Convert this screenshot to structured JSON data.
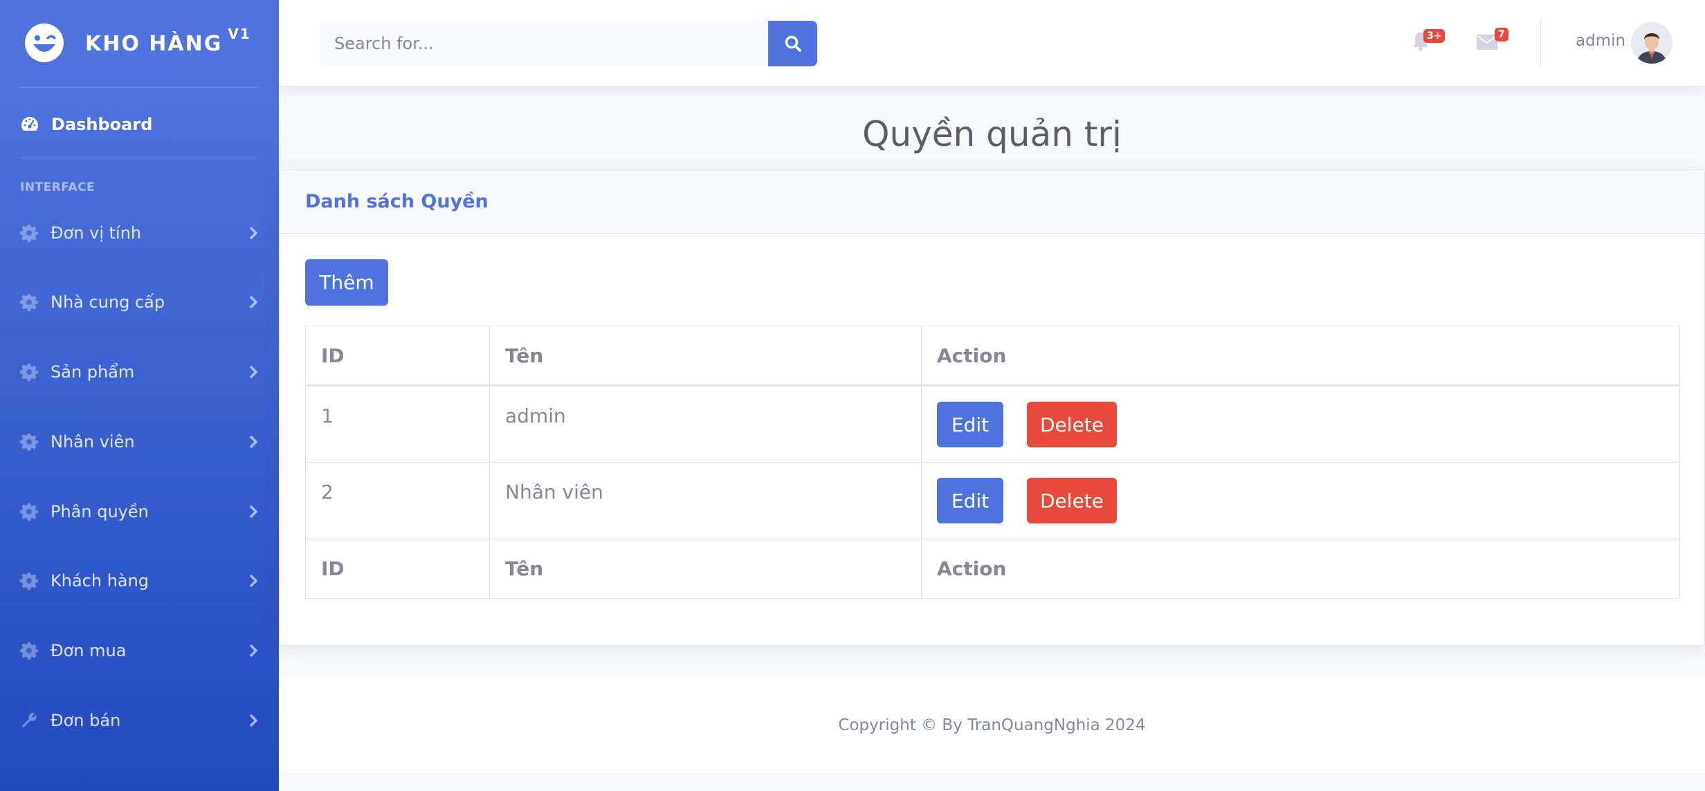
{
  "brand": {
    "name": "KHO HÀNG",
    "version": "V1"
  },
  "sidebar": {
    "dashboard_label": "Dashboard",
    "section_heading": "INTERFACE",
    "items": [
      {
        "label": "Đơn vị tính",
        "icon": "gear-icon"
      },
      {
        "label": "Nhà cung cấp",
        "icon": "gear-icon"
      },
      {
        "label": "Sản phẩm",
        "icon": "gear-icon"
      },
      {
        "label": "Nhân viên",
        "icon": "gear-icon"
      },
      {
        "label": "Phân quyền",
        "icon": "gear-icon"
      },
      {
        "label": "Khách hàng",
        "icon": "gear-icon"
      },
      {
        "label": "Đơn mua",
        "icon": "gear-icon"
      },
      {
        "label": "Đơn bán",
        "icon": "wrench-icon"
      }
    ]
  },
  "topbar": {
    "search_placeholder": "Search for...",
    "alerts_badge": "3+",
    "messages_badge": "7",
    "user_name": "admin"
  },
  "page": {
    "title": "Quyền quản trị",
    "card_title": "Danh sách Quyền",
    "add_label": "Thêm"
  },
  "table": {
    "headers": [
      "ID",
      "Tên",
      "Action"
    ],
    "footers": [
      "ID",
      "Tên",
      "Action"
    ],
    "rows": [
      {
        "id": "1",
        "name": "admin"
      },
      {
        "id": "2",
        "name": "Nhân viên"
      }
    ],
    "edit_label": "Edit",
    "delete_label": "Delete"
  },
  "footer": {
    "copyright": "Copyright © By TranQuangNghia 2024"
  },
  "colors": {
    "primary": "#4e73df",
    "danger": "#e74a3b",
    "text": "#858796"
  }
}
